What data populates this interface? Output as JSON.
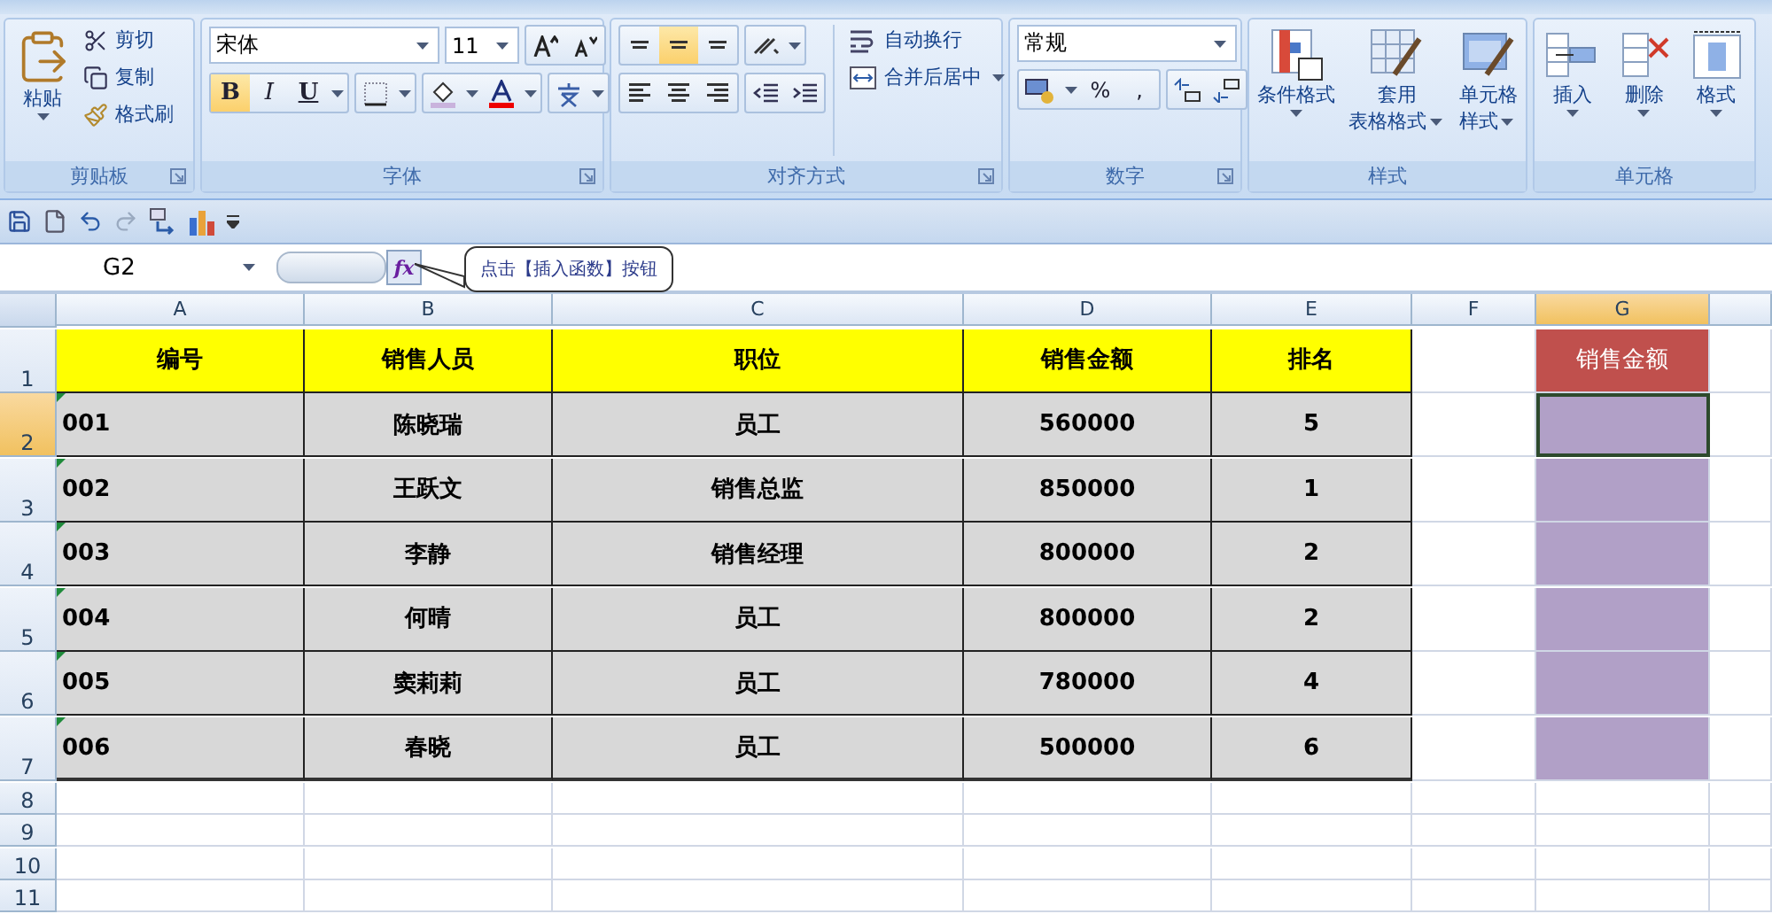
{
  "ribbon": {
    "groups": [
      {
        "kind": "clipboard",
        "label": "剪贴板",
        "launcher": true,
        "paste": "粘贴",
        "items": [
          "剪切",
          "复制",
          "格式刷"
        ]
      },
      {
        "kind": "font",
        "label": "字体",
        "launcher": true,
        "font_name": "宋体",
        "font_size": "11",
        "styles": [
          {
            "label": "B",
            "selected": true
          },
          {
            "label": "I",
            "selected": false
          },
          {
            "label": "U",
            "selected": false
          }
        ]
      },
      {
        "kind": "alignment",
        "label": "对齐方式",
        "launcher": true,
        "vertical": [
          {
            "selected": false
          },
          {
            "selected": true
          },
          {
            "selected": false
          }
        ],
        "horizontal": [
          {
            "selected": false
          },
          {
            "selected": false
          },
          {
            "selected": false
          }
        ],
        "wrap": "自动换行",
        "merge": "合并后居中"
      },
      {
        "kind": "number",
        "label": "数字",
        "launcher": true,
        "format": "常规",
        "symbols": [
          "%",
          ","
        ]
      },
      {
        "kind": "styles",
        "label": "样式",
        "launcher": false,
        "buttons": [
          {
            "lines": [
              "条件格式"
            ]
          },
          {
            "lines": [
              "套用",
              "表格格式"
            ]
          },
          {
            "lines": [
              "单元格",
              "样式"
            ]
          }
        ]
      },
      {
        "kind": "cells",
        "label": "单元格",
        "launcher": false,
        "buttons": [
          {
            "lines": [
              "插入"
            ]
          },
          {
            "lines": [
              "删除"
            ]
          },
          {
            "lines": [
              "格式"
            ]
          }
        ]
      }
    ]
  },
  "formula_bar": {
    "name_box": "G2",
    "function_button": "fx"
  },
  "tooltip": "点击【插入函数】按钮",
  "sheet": {
    "columns": [
      {
        "label": "A",
        "selected": false
      },
      {
        "label": "B",
        "selected": false
      },
      {
        "label": "C",
        "selected": false
      },
      {
        "label": "D",
        "selected": false
      },
      {
        "label": "E",
        "selected": false
      },
      {
        "label": "F",
        "selected": false
      },
      {
        "label": "G",
        "selected": true
      }
    ],
    "rows": [
      {
        "number": "1",
        "selected": false,
        "cells": [
          {
            "text": "编号",
            "kind": "title",
            "selected": false
          },
          {
            "text": "销售人员",
            "kind": "title",
            "selected": false
          },
          {
            "text": "职位",
            "kind": "title",
            "selected": false
          },
          {
            "text": "销售金额",
            "kind": "title",
            "selected": false
          },
          {
            "text": "排名",
            "kind": "title",
            "selected": false
          },
          {
            "kind": "blank",
            "selected": false
          },
          {
            "text": "销售金额",
            "kind": "accent_title",
            "selected": false
          }
        ]
      },
      {
        "number": "2",
        "selected": true,
        "cells": [
          {
            "text": "001",
            "kind": "id",
            "selected": false
          },
          {
            "text": "陈晓瑞",
            "kind": "data",
            "selected": false
          },
          {
            "text": "员工",
            "kind": "data",
            "selected": false
          },
          {
            "text": "560000",
            "kind": "data",
            "selected": false
          },
          {
            "text": "5",
            "kind": "data",
            "selected": false
          },
          {
            "kind": "blank",
            "selected": false
          },
          {
            "kind": "accent",
            "selected": true
          }
        ]
      },
      {
        "number": "3",
        "selected": false,
        "cells": [
          {
            "text": "002",
            "kind": "id",
            "selected": false
          },
          {
            "text": "王跃文",
            "kind": "data",
            "selected": false
          },
          {
            "text": "销售总监",
            "kind": "data",
            "selected": false
          },
          {
            "text": "850000",
            "kind": "data",
            "selected": false
          },
          {
            "text": "1",
            "kind": "data",
            "selected": false
          },
          {
            "kind": "blank",
            "selected": false
          },
          {
            "kind": "accent",
            "selected": false
          }
        ]
      },
      {
        "number": "4",
        "selected": false,
        "cells": [
          {
            "text": "003",
            "kind": "id",
            "selected": false
          },
          {
            "text": "李静",
            "kind": "data",
            "selected": false
          },
          {
            "text": "销售经理",
            "kind": "data",
            "selected": false
          },
          {
            "text": "800000",
            "kind": "data",
            "selected": false
          },
          {
            "text": "2",
            "kind": "data",
            "selected": false
          },
          {
            "kind": "blank",
            "selected": false
          },
          {
            "kind": "accent",
            "selected": false
          }
        ]
      },
      {
        "number": "5",
        "selected": false,
        "cells": [
          {
            "text": "004",
            "kind": "id",
            "selected": false
          },
          {
            "text": "何晴",
            "kind": "data",
            "selected": false
          },
          {
            "text": "员工",
            "kind": "data",
            "selected": false
          },
          {
            "text": "800000",
            "kind": "data",
            "selected": false
          },
          {
            "text": "2",
            "kind": "data",
            "selected": false
          },
          {
            "kind": "blank",
            "selected": false
          },
          {
            "kind": "accent",
            "selected": false
          }
        ]
      },
      {
        "number": "6",
        "selected": false,
        "cells": [
          {
            "text": "005",
            "kind": "id",
            "selected": false
          },
          {
            "text": "窦莉莉",
            "kind": "data",
            "selected": false
          },
          {
            "text": "员工",
            "kind": "data",
            "selected": false
          },
          {
            "text": "780000",
            "kind": "data",
            "selected": false
          },
          {
            "text": "4",
            "kind": "data",
            "selected": false
          },
          {
            "kind": "blank",
            "selected": false
          },
          {
            "kind": "accent",
            "selected": false
          }
        ]
      },
      {
        "number": "7",
        "selected": false,
        "cells": [
          {
            "text": "006",
            "kind": "id",
            "selected": false
          },
          {
            "text": "春晓",
            "kind": "data",
            "selected": false
          },
          {
            "text": "员工",
            "kind": "data",
            "selected": false
          },
          {
            "text": "500000",
            "kind": "data",
            "selected": false
          },
          {
            "text": "6",
            "kind": "data",
            "selected": false
          },
          {
            "kind": "blank",
            "selected": false
          },
          {
            "kind": "accent",
            "selected": false
          }
        ]
      },
      {
        "number": "8",
        "selected": false
      },
      {
        "number": "9",
        "selected": false
      },
      {
        "number": "10",
        "selected": false
      },
      {
        "number": "11",
        "selected": false
      }
    ]
  }
}
